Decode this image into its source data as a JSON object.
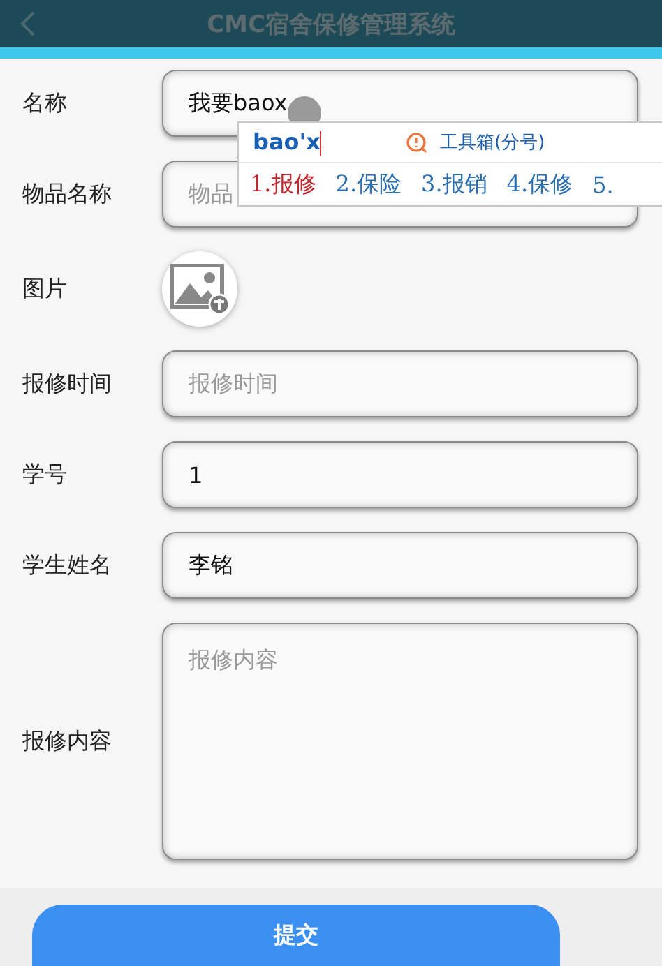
{
  "header": {
    "title": "CMC宿舍保修管理系统"
  },
  "form": [
    {
      "kind": "text",
      "label": "名称",
      "value": "我要baox"
    },
    {
      "kind": "text",
      "label": "物品名称",
      "placeholder": "物品"
    },
    {
      "kind": "image",
      "label": "图片"
    },
    {
      "kind": "text",
      "label": "报修时间",
      "placeholder": "报修时间"
    },
    {
      "kind": "text",
      "label": "学号",
      "value": "1"
    },
    {
      "kind": "text",
      "label": "学生姓名",
      "value": "李铭"
    },
    {
      "kind": "textarea",
      "label": "报修内容",
      "placeholder": "报修内容"
    }
  ],
  "ime": {
    "composition": "bao'x",
    "toolbox": "工具箱(分号)",
    "candidates": [
      {
        "text": "1.报修",
        "selected": true
      },
      {
        "text": "2.保险",
        "selected": false
      },
      {
        "text": "3.报销",
        "selected": false
      },
      {
        "text": "4.保修",
        "selected": false
      },
      {
        "text": "5.",
        "selected": false
      }
    ]
  },
  "submit": "提交"
}
